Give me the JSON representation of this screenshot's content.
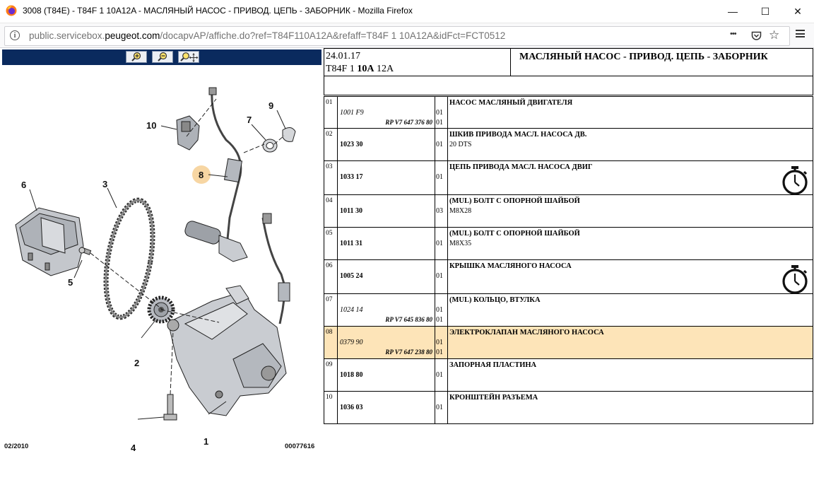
{
  "window": {
    "title": "3008 (T84E) - T84F 1 10A12A - МАСЛЯНЫЙ НАСОС - ПРИВОД. ЦЕПЬ - ЗАБОРНИК - Mozilla Firefox",
    "minimize_icon": "—",
    "maximize_icon": "☐",
    "close_icon": "✕"
  },
  "urlbar": {
    "url_prefix": "public.servicebox.",
    "url_host": "peugeot.com",
    "url_suffix": "/docapvAP/affiche.do?ref=T84F110A12A&refaff=T84F 1 10A12A&idFct=FCT0512",
    "more_icon": "•••",
    "pocket_icon": "pocket-icon",
    "star_icon": "☆"
  },
  "diagram": {
    "callouts": [
      {
        "label": "1"
      },
      {
        "label": "2"
      },
      {
        "label": "3"
      },
      {
        "label": "4"
      },
      {
        "label": "5"
      },
      {
        "label": "6"
      },
      {
        "label": "7"
      },
      {
        "label": "8"
      },
      {
        "label": "9"
      },
      {
        "label": "10"
      }
    ],
    "highlight_color": "#f7d6a3",
    "footer_left": "02/2010",
    "footer_right": "00077616"
  },
  "header": {
    "date": "24.01.17",
    "model_a": "T84F 1 ",
    "model_b": "10A",
    "model_c": " 12A",
    "title": "МАСЛЯНЫЙ НАСОС - ПРИВОД. ЦЕПЬ - ЗАБОРНИК"
  },
  "parts": [
    {
      "num": "01",
      "ref": "1001 F9",
      "ref_style": "it",
      "rp": "RP V7 647 376 80",
      "qty": "01",
      "qty2": "01",
      "desc": "НАСОС МАСЛЯНЫЙ ДВИГАТЕЛЯ",
      "sub": "",
      "timer": false,
      "highlight": false
    },
    {
      "num": "02",
      "ref": "1023 30",
      "ref_style": "bold",
      "rp": "",
      "qty": "01",
      "qty2": "",
      "desc": "ШКИВ ПРИВОДА МАСЛ. НАСОСА ДВ.",
      "sub": "20 DTS",
      "timer": false,
      "highlight": false
    },
    {
      "num": "03",
      "ref": "1033 17",
      "ref_style": "bold",
      "rp": "",
      "qty": "01",
      "qty2": "",
      "desc": "ЦЕПЬ ПРИВОДА МАСЛ. НАСОСА ДВИГ",
      "sub": "",
      "timer": true,
      "highlight": false
    },
    {
      "num": "04",
      "ref": "1011 30",
      "ref_style": "bold",
      "rp": "",
      "qty": "03",
      "qty2": "",
      "desc": "(MUL) БОЛТ С ОПОРНОЙ ШАЙБОЙ",
      "sub": "M8X28",
      "timer": false,
      "highlight": false
    },
    {
      "num": "05",
      "ref": "1011 31",
      "ref_style": "bold",
      "rp": "",
      "qty": "01",
      "qty2": "",
      "desc": "(MUL) БОЛТ С ОПОРНОЙ ШАЙБОЙ",
      "sub": "M8X35",
      "timer": false,
      "highlight": false
    },
    {
      "num": "06",
      "ref": "1005 24",
      "ref_style": "bold",
      "rp": "",
      "qty": "01",
      "qty2": "",
      "desc": "КРЫШКА МАСЛЯНОГО НАСОСА",
      "sub": "",
      "timer": true,
      "highlight": false
    },
    {
      "num": "07",
      "ref": "1024 14",
      "ref_style": "it",
      "rp": "RP V7 645 836 80",
      "qty": "01",
      "qty2": "01",
      "desc": "(MUL) КОЛЬЦО, ВТУЛКА",
      "sub": "",
      "timer": false,
      "highlight": false
    },
    {
      "num": "08",
      "ref": "0379 90",
      "ref_style": "it",
      "rp": "RP V7 647 238 80",
      "qty": "01",
      "qty2": "01",
      "desc": "ЭЛЕКТРОКЛАПАН МАСЛЯНОГО НАСОСА",
      "sub": "",
      "timer": false,
      "highlight": true
    },
    {
      "num": "09",
      "ref": "1018 80",
      "ref_style": "bold",
      "rp": "",
      "qty": "01",
      "qty2": "",
      "desc": "ЗАПОРНАЯ ПЛАСТИНА",
      "sub": "",
      "timer": false,
      "highlight": false
    },
    {
      "num": "10",
      "ref": "1036 03",
      "ref_style": "bold",
      "rp": "",
      "qty": "01",
      "qty2": "",
      "desc": "КРОНШТЕЙН РАЗЪЕМА",
      "sub": "",
      "timer": false,
      "highlight": false
    }
  ]
}
